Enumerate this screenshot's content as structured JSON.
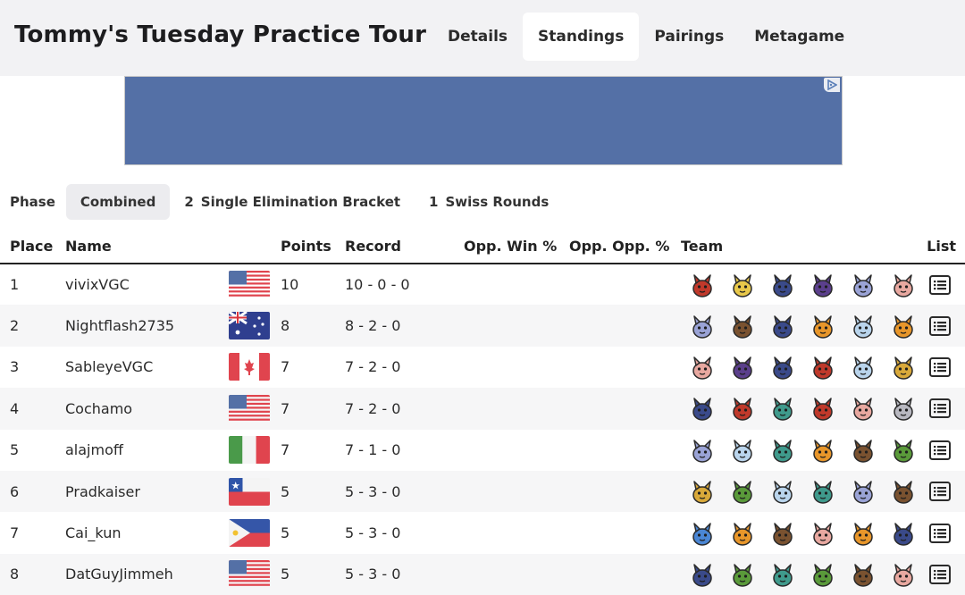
{
  "header": {
    "title": "Tommy's Tuesday Practice Tour",
    "tabs": [
      {
        "label": "Details",
        "active": false
      },
      {
        "label": "Standings",
        "active": true
      },
      {
        "label": "Pairings",
        "active": false
      },
      {
        "label": "Metagame",
        "active": false
      }
    ]
  },
  "ad": {
    "color": "#5470a6"
  },
  "phase": {
    "label": "Phase",
    "options": [
      {
        "number": "",
        "label": "Combined",
        "active": true
      },
      {
        "number": "2",
        "label": "Single Elimination Bracket",
        "active": false
      },
      {
        "number": "1",
        "label": "Swiss Rounds",
        "active": false
      }
    ]
  },
  "table": {
    "columns": [
      "Place",
      "Name",
      "",
      "Points",
      "Record",
      "Opp. Win %",
      "Opp. Opp. %",
      "Team",
      "List"
    ],
    "rows": [
      {
        "place": "1",
        "name": "vivixVGC",
        "flag": "us",
        "points": "10",
        "record": "10 - 0 - 0",
        "opp_win": "",
        "opp_opp": "",
        "team": [
          "red",
          "yellow",
          "navy",
          "purple",
          "lilac",
          "pink"
        ]
      },
      {
        "place": "2",
        "name": "Nightflash2735",
        "flag": "au",
        "points": "8",
        "record": "8 - 2 - 0",
        "opp_win": "",
        "opp_opp": "",
        "team": [
          "lilac",
          "brown",
          "navy",
          "orange",
          "ice",
          "orange"
        ]
      },
      {
        "place": "3",
        "name": "SableyeVGC",
        "flag": "ca",
        "points": "7",
        "record": "7 - 2 - 0",
        "opp_win": "",
        "opp_opp": "",
        "team": [
          "pink",
          "purple",
          "navy",
          "red",
          "ice",
          "gold"
        ]
      },
      {
        "place": "4",
        "name": "Cochamo",
        "flag": "us",
        "points": "7",
        "record": "7 - 2 - 0",
        "opp_win": "",
        "opp_opp": "",
        "team": [
          "navy",
          "red",
          "teal",
          "red",
          "pink",
          "grey"
        ]
      },
      {
        "place": "5",
        "name": "alajmoff",
        "flag": "it",
        "points": "7",
        "record": "7 - 1 - 0",
        "opp_win": "",
        "opp_opp": "",
        "team": [
          "lilac",
          "ice",
          "teal",
          "orange",
          "brown",
          "green"
        ]
      },
      {
        "place": "6",
        "name": "Pradkaiser",
        "flag": "cl",
        "points": "5",
        "record": "5 - 3 - 0",
        "opp_win": "",
        "opp_opp": "",
        "team": [
          "gold",
          "green",
          "ice",
          "teal",
          "lilac",
          "brown"
        ]
      },
      {
        "place": "7",
        "name": "Cai_kun",
        "flag": "ph",
        "points": "5",
        "record": "5 - 3 - 0",
        "opp_win": "",
        "opp_opp": "",
        "team": [
          "blue",
          "orange",
          "brown",
          "pink",
          "orange",
          "navy"
        ]
      },
      {
        "place": "8",
        "name": "DatGuyJimmeh",
        "flag": "us",
        "points": "5",
        "record": "5 - 3 - 0",
        "opp_win": "",
        "opp_opp": "",
        "team": [
          "navy",
          "green",
          "teal",
          "green",
          "brown",
          "pink"
        ]
      }
    ]
  },
  "palette": {
    "red": "#c0392b",
    "yellow": "#e8c84a",
    "navy": "#3a4a8a",
    "purple": "#5b3f8c",
    "lilac": "#9aa3d6",
    "pink": "#e8a8a0",
    "brown": "#7a5230",
    "orange": "#e8962a",
    "ice": "#b9d4ec",
    "gold": "#d9a93a",
    "teal": "#3f9a8c",
    "grey": "#b8b8c0",
    "green": "#5a9a3a",
    "blue": "#4a86d4"
  },
  "icons": {
    "list": "list-icon",
    "ad_choices": "ad-choices-icon"
  }
}
